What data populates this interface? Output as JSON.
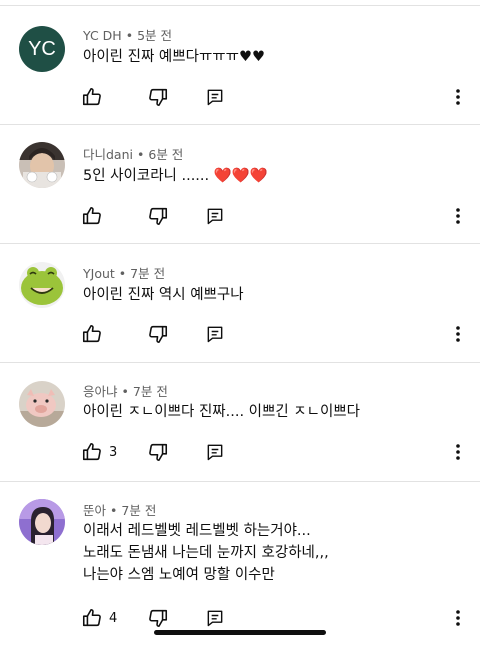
{
  "comments": [
    {
      "author": "YC DH",
      "time": "5분 전",
      "avatar_initials": "YC",
      "avatar_color": "#1f4f45",
      "lines": [
        "아이린 진짜 예쁘다ㅠㅠㅠ♥︎♥︎"
      ],
      "likes": ""
    },
    {
      "author": "다니dani",
      "time": "6분 전",
      "lines": [
        "5인 사이코라니 ...... ❤️❤️❤️"
      ],
      "likes": ""
    },
    {
      "author": "YJout",
      "time": "7분 전",
      "lines": [
        "아이린 진짜 역시 예쁘구나"
      ],
      "likes": ""
    },
    {
      "author": "응아냐",
      "time": "7분 전",
      "lines": [
        "아이린 ㅈㄴ이쁘다 진짜.... 이쁘긴 ㅈㄴ이쁘다"
      ],
      "likes": "3"
    },
    {
      "author": "뚠아",
      "time": "7분 전",
      "lines": [
        "이래서 레드벨벳 레드벨벳 하는거야...",
        "노래도 돈냄새 나는데 눈까지 호강하네,,,",
        "나는야 스엠 노예여 망할 이수만"
      ],
      "likes": "4"
    }
  ],
  "meta_separator": "•",
  "icons": {
    "like": "thumb-up-icon",
    "dislike": "thumb-down-icon",
    "reply": "reply-icon",
    "more": "more-vert-icon"
  }
}
